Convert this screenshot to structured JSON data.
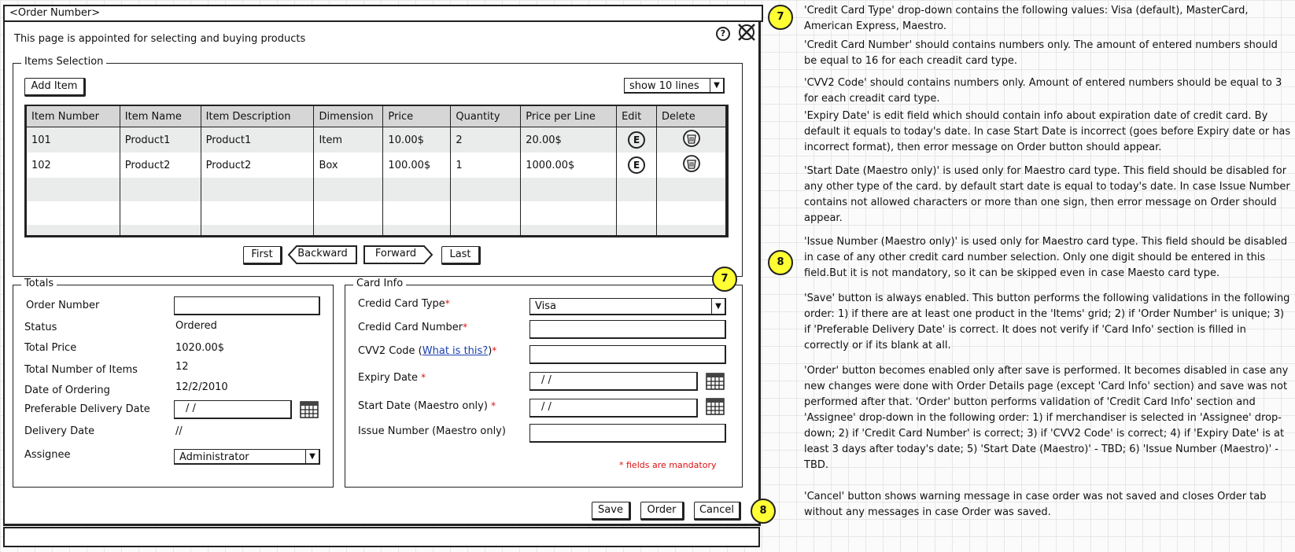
{
  "window": {
    "title": "<Order Number>",
    "intro": "This page is appointed for selecting and buying products",
    "help_icon_glyph": "?",
    "close_icon_glyph": "✕"
  },
  "items": {
    "legend": "Items Selection",
    "add_item_label": "Add Item",
    "show_lines_value": "show 10 lines",
    "columns": [
      "Item Number",
      "Item Name",
      "Item Description",
      "Dimension",
      "Price",
      "Quantity",
      "Price per Line",
      "Edit",
      "Delete"
    ],
    "rows": [
      {
        "number": "101",
        "name": "Product1",
        "description": "Product1",
        "dimension": "Item",
        "price": "10.00$",
        "quantity": "2",
        "price_per_line": "20.00$"
      },
      {
        "number": "102",
        "name": "Product2",
        "description": "Product2",
        "dimension": "Box",
        "price": "100.00$",
        "quantity": "1",
        "price_per_line": "1000.00$"
      }
    ],
    "edit_glyph": "E",
    "pager": {
      "first": "First",
      "backward": "Backward",
      "forward": "Forward",
      "last": "Last"
    }
  },
  "totals": {
    "legend": "Totals",
    "order_number_label": "Order Number",
    "status_label": "Status",
    "status_value": "Ordered",
    "total_price_label": "Total Price",
    "total_price_value": "1020.00$",
    "total_items_label": "Total Number of Items",
    "total_items_value": "12",
    "date_ordering_label": "Date of Ordering",
    "date_ordering_value": "12/2/2010",
    "pref_delivery_label": "Preferable Delivery Date",
    "pref_delivery_value": "/ /",
    "delivery_date_label": "Delivery Date",
    "delivery_date_value": "//",
    "assignee_label": "Assignee",
    "assignee_value": "Administrator"
  },
  "card": {
    "legend": "Card Info",
    "type_label": "Credid Card Type",
    "type_value": "Visa",
    "number_label": "Credid Card Number",
    "cvv_label_prefix": "CVV2 Code (",
    "cvv_link": "What is this?",
    "cvv_label_suffix": ")",
    "expiry_label": "Expiry Date",
    "expiry_value": "/ /",
    "start_label": "Start Date (Maestro only)",
    "start_value": "/ /",
    "issue_label": "Issue Number (Maestro only)",
    "mandatory_note": "* fields are mandatory",
    "required_mark": "*"
  },
  "actions": {
    "save": "Save",
    "order": "Order",
    "cancel": "Cancel"
  },
  "badges": {
    "seven": "7",
    "eight": "8"
  },
  "notes": [
    "'Credit Card Type' drop-down contains the following values: Visa (default), MasterCard, American Express, Maestro.",
    "'Credit Card Number' should contains numbers only. The amount of entered numbers should be equal to 16 for each creadit card type.",
    "'CVV2 Code' should contains numbers only. Amount of entered numbers should be equal to 3 for each creadit card type.",
    "'Expiry Date' is edit field which should contain info about expiration date of credit card. By default it equals to today's date. In case Start Date is incorrect (goes before Expiry date or has incorrect format), then error message on Order button should appear.",
    "'Start Date (Maestro only)' is used only for Maestro card type. This field should be disabled for any other type of the card. by default start date is equal to today's date. In case Issue Number contains not allowed characters or more than one sign, then error message on Order should appear.",
    "'Issue Number (Maestro only)' is used only for Maestro card type. This field should be disabled in case of any other credit card number selection. Only one digit should be entered in this field.But it is not mandatory, so it can be skipped even in case Maesto card type.",
    "'Save' button is always enabled. This button performs the following validations in the following order: 1) if there are at least one product in the 'Items' grid; 2) if 'Order Number' is unique; 3) if 'Preferable Delivery Date' is correct. It does not verify if 'Card Info' section is filled in correctly or if its blank at all.",
    "'Order' button becomes enabled only after save is performed. It becomes disabled in case any new changes were done with Order Details page (except 'Card Info' section) and save was not performed after that. 'Order' button performs validation of 'Credit Card Info' section and 'Assignee' drop-down in the following order: 1) if merchandiser is selected in 'Assignee' drop-down; 2) if 'Credit Card Number' is correct; 3) if 'CVV2 Code' is correct; 4) if 'Expiry Date' is at least 3 days after today's date; 5) 'Start Date (Maestro)' - TBD; 6) 'Issue Number (Maestro)' - TBD.",
    "'Cancel' button shows warning message in case order was not saved and closes Order tab without any messages in case Order was saved."
  ]
}
